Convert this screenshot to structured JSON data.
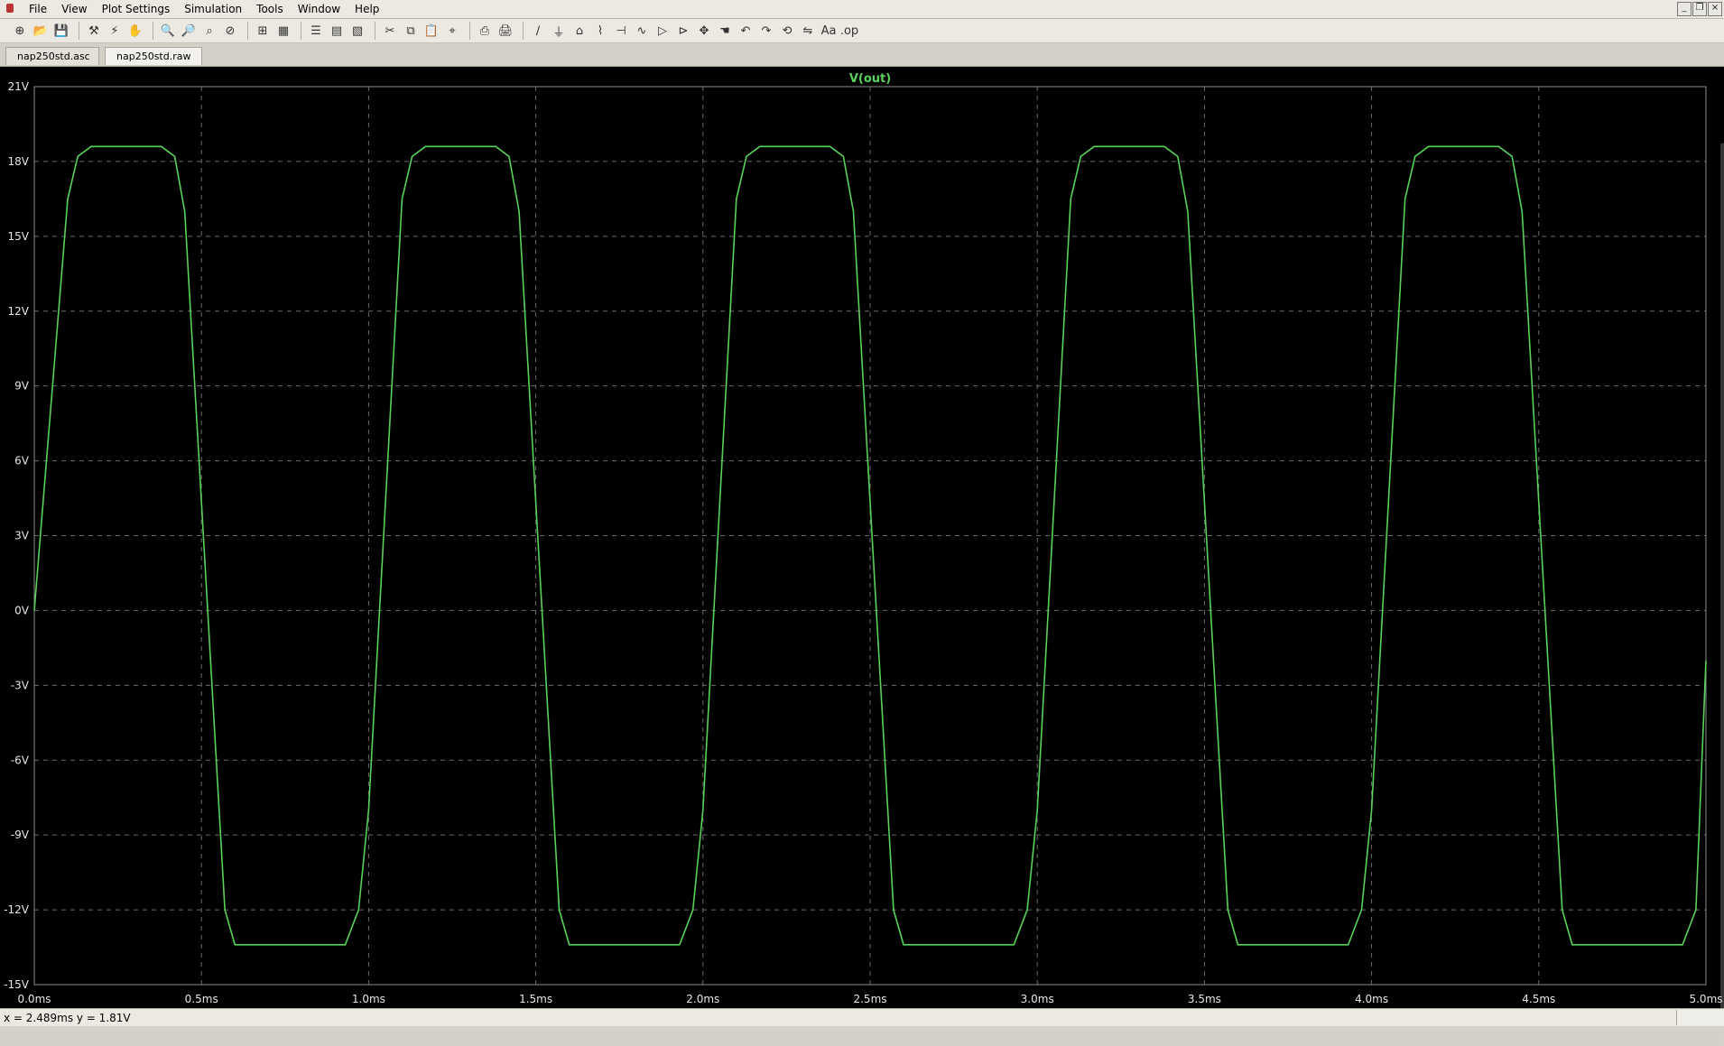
{
  "menubar": {
    "items": [
      "File",
      "View",
      "Plot Settings",
      "Simulation",
      "Tools",
      "Window",
      "Help"
    ],
    "window_controls": [
      "minimize",
      "restore",
      "close"
    ]
  },
  "toolbar": {
    "groups": [
      [
        "new-schematic-icon",
        "open-icon",
        "save-icon"
      ],
      [
        "control-panel-icon",
        "run-icon",
        "halt-icon"
      ],
      [
        "zoom-in-icon",
        "zoom-out-icon",
        "zoom-full-icon",
        "zoom-cancel-icon"
      ],
      [
        "autorange-icon",
        "grid-icon"
      ],
      [
        "tile-horizontal-icon",
        "tile-vertical-icon",
        "cascade-icon"
      ],
      [
        "cut-icon",
        "copy-icon",
        "paste-icon",
        "find-icon"
      ],
      [
        "print-preview-icon",
        "print-icon"
      ],
      [
        "wire-icon",
        "ground-icon",
        "label-icon",
        "resistor-icon",
        "capacitor-icon",
        "inductor-icon",
        "diode-icon",
        "component-icon",
        "move-icon",
        "drag-icon",
        "undo-icon",
        "redo-icon",
        "rotate-icon",
        "mirror-icon",
        "text-icon",
        "spice-directive-icon"
      ]
    ]
  },
  "tabs": [
    {
      "label": "nap250std.asc",
      "active": false
    },
    {
      "label": "nap250std.raw",
      "active": true
    }
  ],
  "plot": {
    "background": "#000000",
    "trace_color": "#58d25a"
  },
  "chart_data": {
    "type": "line",
    "title": "V(out)",
    "xlabel": "",
    "ylabel": "",
    "xlim": [
      0,
      5
    ],
    "ylim": [
      -15,
      21
    ],
    "x_unit": "ms",
    "y_unit": "V",
    "x_ticks": [
      "0.0ms",
      "0.5ms",
      "1.0ms",
      "1.5ms",
      "2.0ms",
      "2.5ms",
      "3.0ms",
      "3.5ms",
      "4.0ms",
      "4.5ms",
      "5.0ms"
    ],
    "y_ticks": [
      "21V",
      "18V",
      "15V",
      "12V",
      "9V",
      "6V",
      "3V",
      "0V",
      "-3V",
      "-6V",
      "-9V",
      "-12V",
      "-15V"
    ],
    "grid": true,
    "series": [
      {
        "name": "V(out)",
        "x": [
          0,
          0.1,
          0.13,
          0.17,
          0.38,
          0.42,
          0.45,
          0.57,
          0.6,
          0.64,
          0.93,
          0.97,
          1.0,
          1.1,
          1.13,
          1.17,
          1.38,
          1.42,
          1.45,
          1.57,
          1.6,
          1.64,
          1.93,
          1.97,
          2.0,
          2.1,
          2.13,
          2.17,
          2.38,
          2.42,
          2.45,
          2.57,
          2.6,
          2.64,
          2.93,
          2.97,
          3.0,
          3.1,
          3.13,
          3.17,
          3.38,
          3.42,
          3.45,
          3.57,
          3.6,
          3.64,
          3.93,
          3.97,
          4.0,
          4.1,
          4.13,
          4.17,
          4.38,
          4.42,
          4.45,
          4.57,
          4.6,
          4.64,
          4.93,
          4.97,
          5.0
        ],
        "y": [
          0,
          16.5,
          18.2,
          18.6,
          18.6,
          18.2,
          16.0,
          -12.0,
          -13.4,
          -13.4,
          -13.4,
          -12.0,
          -8.0,
          16.5,
          18.2,
          18.6,
          18.6,
          18.2,
          16.0,
          -12.0,
          -13.4,
          -13.4,
          -13.4,
          -12.0,
          -8.0,
          16.5,
          18.2,
          18.6,
          18.6,
          18.2,
          16.0,
          -12.0,
          -13.4,
          -13.4,
          -13.4,
          -12.0,
          -8.0,
          16.5,
          18.2,
          18.6,
          18.6,
          18.2,
          16.0,
          -12.0,
          -13.4,
          -13.4,
          -13.4,
          -12.0,
          -8.0,
          16.5,
          18.2,
          18.6,
          18.6,
          18.2,
          16.0,
          -12.0,
          -13.4,
          -13.4,
          -13.4,
          -12.0,
          -2.0
        ]
      }
    ]
  },
  "statusbar": {
    "cursor_readout": "x = 2.489ms   y = 1.81V"
  }
}
